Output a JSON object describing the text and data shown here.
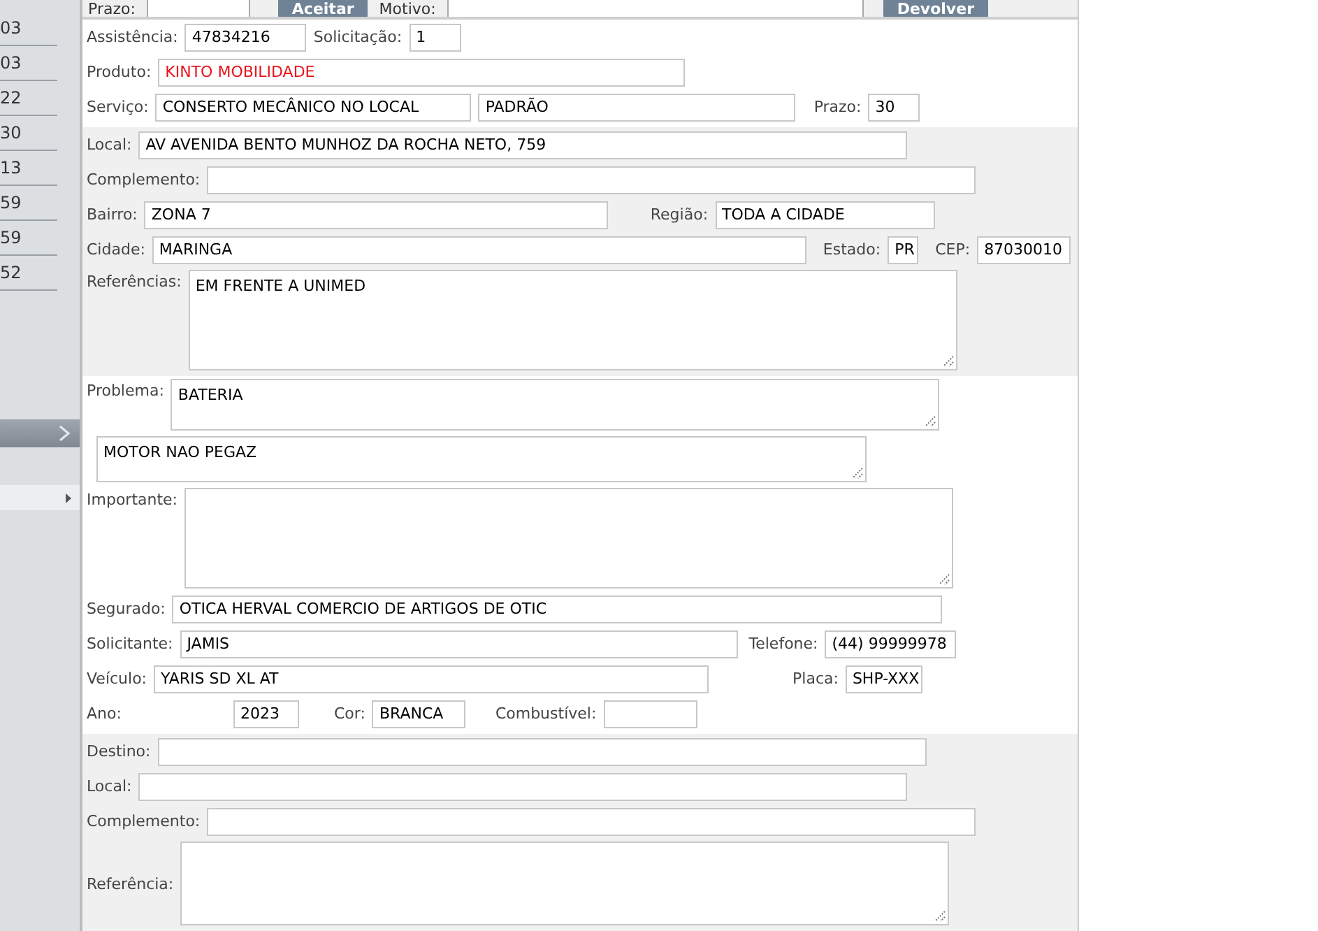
{
  "top_bar": {
    "prazo_label": "Prazo:",
    "accept_button": "Aceitar",
    "motivo_label": "Motivo:",
    "return_button": "Devolver"
  },
  "sidebar": {
    "items": [
      "03",
      "03",
      "22",
      "30",
      "13",
      "59",
      "59",
      "52"
    ]
  },
  "sections": [
    {
      "shaded": false,
      "rows": [
        {
          "fields": [
            {
              "kind": "input",
              "label": "Assistência:",
              "value": "47834216"
            },
            {
              "kind": "input",
              "label": "Solicitação:",
              "value": "1"
            }
          ]
        },
        {
          "fields": [
            {
              "kind": "input",
              "label": "Produto:",
              "value": "KINTO MOBILIDADE",
              "color": "#e8141b"
            }
          ]
        },
        {
          "fields": [
            {
              "kind": "input",
              "label": "Serviço:",
              "value": "CONSERTO MECÂNICO NO LOCAL"
            },
            {
              "kind": "input",
              "value": "PADRÃO"
            },
            {
              "kind": "input",
              "label": "Prazo:",
              "value": "30"
            }
          ]
        }
      ]
    },
    {
      "shaded": true,
      "rows": [
        {
          "fields": [
            {
              "kind": "input",
              "label": "Local:",
              "value": "AV AVENIDA BENTO MUNHOZ DA ROCHA NETO, 759"
            }
          ]
        },
        {
          "fields": [
            {
              "kind": "input",
              "label": "Complemento:"
            }
          ]
        },
        {
          "fields": [
            {
              "kind": "input",
              "label": "Bairro:",
              "value": "ZONA 7"
            },
            {
              "kind": "input",
              "label": "Região:",
              "value": "TODA A CIDADE"
            }
          ]
        },
        {
          "fields": [
            {
              "kind": "input",
              "label": "Cidade:",
              "value": "MARINGA"
            },
            {
              "kind": "input",
              "label": "Estado:",
              "value": "PR"
            },
            {
              "kind": "input",
              "label": "CEP:",
              "value": "87030010"
            }
          ]
        },
        {
          "fields": [
            {
              "kind": "textarea",
              "label": "Referências:",
              "value": "EM FRENTE A UNIMED"
            }
          ]
        }
      ]
    },
    {
      "shaded": false,
      "rows": [
        {
          "fields": [
            {
              "kind": "textarea",
              "label": "Problema:",
              "value": "BATERIA"
            }
          ]
        },
        {
          "fields": [
            {
              "kind": "textarea",
              "value": "MOTOR NAO PEGAZ"
            }
          ]
        },
        {
          "fields": [
            {
              "kind": "textarea",
              "label": "Importante:"
            }
          ]
        },
        {
          "fields": [
            {
              "kind": "input",
              "label": "Segurado:",
              "value": "OTICA HERVAL COMERCIO DE ARTIGOS DE OTIC"
            }
          ]
        },
        {
          "fields": [
            {
              "kind": "input",
              "label": "Solicitante:",
              "value": "JAMIS"
            },
            {
              "kind": "input",
              "label": "Telefone:",
              "value": "(44) 99999978"
            }
          ]
        },
        {
          "fields": [
            {
              "kind": "input",
              "label": "Veículo:",
              "value": "YARIS SD XL AT"
            },
            {
              "kind": "input",
              "label": "Placa:",
              "value": "SHP-XXX"
            }
          ]
        },
        {
          "fields": [
            {
              "kind": "input",
              "label": "Ano:",
              "value": "2023"
            },
            {
              "kind": "input",
              "label": "Cor:",
              "value": "BRANCA"
            },
            {
              "kind": "input",
              "label": "Combustível:"
            }
          ]
        }
      ]
    },
    {
      "shaded": true,
      "rows": [
        {
          "fields": [
            {
              "kind": "input",
              "label": "Destino:"
            }
          ]
        },
        {
          "fields": [
            {
              "kind": "input",
              "label": "Local:"
            }
          ]
        },
        {
          "fields": [
            {
              "kind": "input",
              "label": "Complemento:"
            }
          ]
        },
        {
          "fields": [
            {
              "kind": "textarea",
              "label": "Referência:",
              "centered": true
            }
          ]
        }
      ]
    }
  ]
}
